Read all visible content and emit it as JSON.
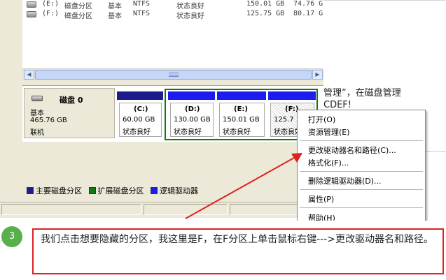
{
  "volumes": [
    {
      "drive": "(E:)",
      "layout": "磁盘分区",
      "type": "基本",
      "fs": "NTFS",
      "status": "状态良好",
      "capacity": "150.01 GB",
      "free": "74.76 G"
    },
    {
      "drive": "(F:)",
      "layout": "磁盘分区",
      "type": "基本",
      "fs": "NTFS",
      "status": "状态良好",
      "capacity": "125.75 GB",
      "free": "80.17 G"
    }
  ],
  "disk": {
    "name": "磁盘 0",
    "type": "基本",
    "size": "465.76 GB",
    "state": "联机"
  },
  "partitions": [
    {
      "label": "(C:)",
      "size": "60.00 GB",
      "status": "状态良好"
    },
    {
      "label": "(D:)",
      "size": "130.00 GB",
      "status": "状态良好"
    },
    {
      "label": "(E:)",
      "size": "150.01 GB",
      "status": "状态良好"
    },
    {
      "label": "(F:)",
      "size": "125.7",
      "status": "状态良好"
    }
  ],
  "legend": [
    {
      "label": "主要磁盘分区",
      "color": "#1c1c8c"
    },
    {
      "label": "扩展磁盘分区",
      "color": "#137a13"
    },
    {
      "label": "逻辑驱动器",
      "color": "#1c1cf0"
    }
  ],
  "context_menu": {
    "items": [
      {
        "label": "打开(O)"
      },
      {
        "label": "资源管理(E)"
      },
      {
        "label": "更改驱动器名和路径(C)..."
      },
      {
        "label": "格式化(F)..."
      },
      {
        "label": "删除逻辑驱动器(D)..."
      },
      {
        "label": "属性(P)"
      },
      {
        "label": "帮助(H)"
      }
    ]
  },
  "background_text": {
    "line1": "管理”，在磁盘管理",
    "line2": "CDEF!"
  },
  "step": {
    "number": "3",
    "text": "我们点击想要隐藏的分区，我这里是F，在F分区上单击鼠标右键--->更改驱动器名和路径。"
  },
  "accent": {
    "step_green": "#57b04a",
    "highlight_red": "#e02020",
    "partition_blue": "#1c1cc8",
    "extended_green": "#137a13"
  }
}
